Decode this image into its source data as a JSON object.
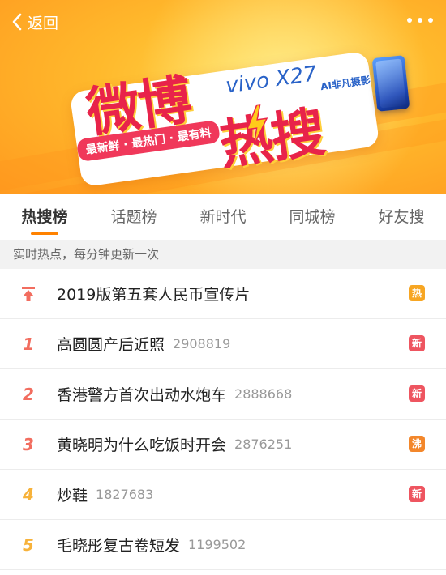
{
  "header": {
    "back_label": "返回",
    "more_icon": "more-dots-icon",
    "back_icon": "chevron-left-icon"
  },
  "banner": {
    "logo_part1": "微博",
    "logo_part2": "热搜",
    "slogan": "最新鲜 · 最热门 · 最有料",
    "brand": "vivo X27",
    "brand_tag": "AI非凡摄影"
  },
  "tabs": [
    {
      "label": "热搜榜",
      "active": true
    },
    {
      "label": "话题榜",
      "active": false
    },
    {
      "label": "新时代",
      "active": false
    },
    {
      "label": "同城榜",
      "active": false
    },
    {
      "label": "好友搜",
      "active": false
    }
  ],
  "subheader": "实时热点，每分钟更新一次",
  "list": [
    {
      "rank": "",
      "title": "2019版第五套人民币宣传片",
      "count": "",
      "badge": "热",
      "badge_type": "hot"
    },
    {
      "rank": "1",
      "title": "高圆圆产后近照",
      "count": "2908819",
      "badge": "新",
      "badge_type": "new"
    },
    {
      "rank": "2",
      "title": "香港警方首次出动水炮车",
      "count": "2888668",
      "badge": "新",
      "badge_type": "new"
    },
    {
      "rank": "3",
      "title": "黄晓明为什么吃饭时开会",
      "count": "2876251",
      "badge": "沸",
      "badge_type": "boil"
    },
    {
      "rank": "4",
      "title": "炒鞋",
      "count": "1827683",
      "badge": "新",
      "badge_type": "new"
    },
    {
      "rank": "5",
      "title": "毛晓彤复古卷短发",
      "count": "1199502",
      "badge": "",
      "badge_type": ""
    }
  ],
  "colors": {
    "accent": "#ff8200",
    "hot": "#f7a623",
    "new": "#ee5560",
    "boil": "#f3872b",
    "logo_red": "#e8234a"
  }
}
